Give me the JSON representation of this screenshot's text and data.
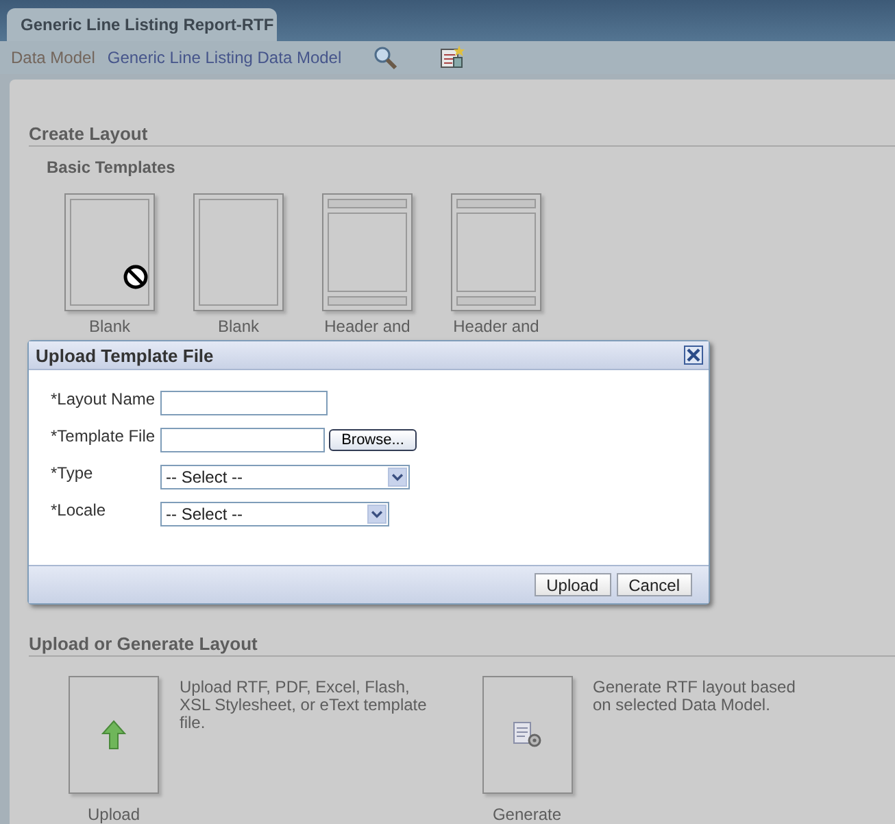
{
  "tab": {
    "title": "Generic Line Listing Report-RTF"
  },
  "breadcrumb": {
    "label": "Data Model",
    "link": "Generic Line Listing Data Model"
  },
  "create_layout": {
    "title": "Create Layout",
    "subtitle": "Basic Templates",
    "templates": [
      {
        "kind": "blank",
        "label": "Blank"
      },
      {
        "kind": "blank",
        "label": "Blank"
      },
      {
        "kind": "header_footer",
        "label": "Header and"
      },
      {
        "kind": "header_footer",
        "label": "Header and"
      }
    ]
  },
  "dialog": {
    "title": "Upload Template File",
    "fields": [
      {
        "kind": "text",
        "label": "*Layout Name"
      },
      {
        "kind": "file",
        "label": "*Template File",
        "button": "Browse..."
      },
      {
        "kind": "select",
        "label": "*Type",
        "value": "-- Select --"
      },
      {
        "kind": "select",
        "label": "*Locale",
        "value": "-- Select --"
      }
    ],
    "buttons": [
      "Upload",
      "Cancel"
    ]
  },
  "upload_generate": {
    "title": "Upload or Generate Layout",
    "options": [
      {
        "kind": "upload",
        "label": "Upload",
        "description": "Upload RTF, PDF, Excel, Flash, XSL Stylesheet, or eText template file."
      },
      {
        "kind": "generate",
        "label": "Generate",
        "description": "Generate RTF layout based on selected Data Model."
      }
    ]
  }
}
